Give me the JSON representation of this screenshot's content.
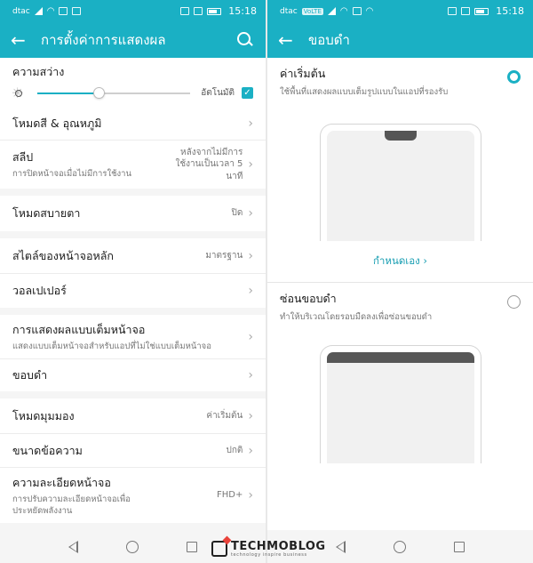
{
  "status_left": {
    "carrier": "dtac",
    "time": "15:18"
  },
  "status_right": {
    "carrier": "dtac",
    "badge": "VoLTE",
    "time": "15:18"
  },
  "left": {
    "title": "การตั้งค่าการแสดงผล",
    "brightness": {
      "label": "ความสว่าง",
      "level": 0.4,
      "auto_label": "อัตโนมัติ",
      "auto_checked": true
    },
    "rows": {
      "color_temp": {
        "label": "โหมดสี & อุณหภูมิ"
      },
      "sleep": {
        "label": "สลีป",
        "sub": "การปิดหน้าจอเมื่อไม่มีการใช้งาน",
        "value_line1": "หลังจากไม่มีการ",
        "value_line2": "ใช้งานเป็นเวลา 5",
        "value_line3": "นาที"
      },
      "eye_comfort": {
        "label": "โหมดสบายตา",
        "value": "ปิด"
      },
      "home_style": {
        "label": "สไตล์ของหน้าจอหลัก",
        "value": "มาตรฐาน"
      },
      "wallpaper": {
        "label": "วอลเปเปอร์"
      },
      "fullscreen": {
        "label": "การแสดงผลแบบเต็มหน้าจอ",
        "sub": "แสดงแบบเต็มหน้าจอสำหรับแอปที่ไม่ใช่แบบเต็มหน้าจอ"
      },
      "notch": {
        "label": "ขอบดำ"
      },
      "view_mode": {
        "label": "โหมดมุมมอง",
        "value": "ค่าเริ่มต้น"
      },
      "text_size": {
        "label": "ขนาดข้อความ",
        "value": "ปกติ"
      },
      "resolution": {
        "label": "ความละเอียดหน้าจอ",
        "sub_line1": "การปรับความละเอียดหน้าจอเพื่อ",
        "sub_line2": "ประหยัดพลังงาน",
        "value": "FHD+"
      }
    }
  },
  "right": {
    "title": "ขอบดำ",
    "option_default": {
      "label": "ค่าเริ่มต้น",
      "sub": "ใช้พื้นที่แสดงผลแบบเต็มรูปแบบในแอปที่รองรับ",
      "selected": true
    },
    "customize": "กำหนดเอง",
    "option_hide": {
      "label": "ซ่อนขอบดำ",
      "sub": "ทำให้บริเวณโดยรอบมืดลงเพื่อซ่อนขอบดำ",
      "selected": false
    }
  },
  "logo": {
    "name": "TECHMOBLOG",
    "tagline": "technology inspire business"
  },
  "colors": {
    "accent": "#1ab0c4",
    "background": "#f5f5f5"
  }
}
